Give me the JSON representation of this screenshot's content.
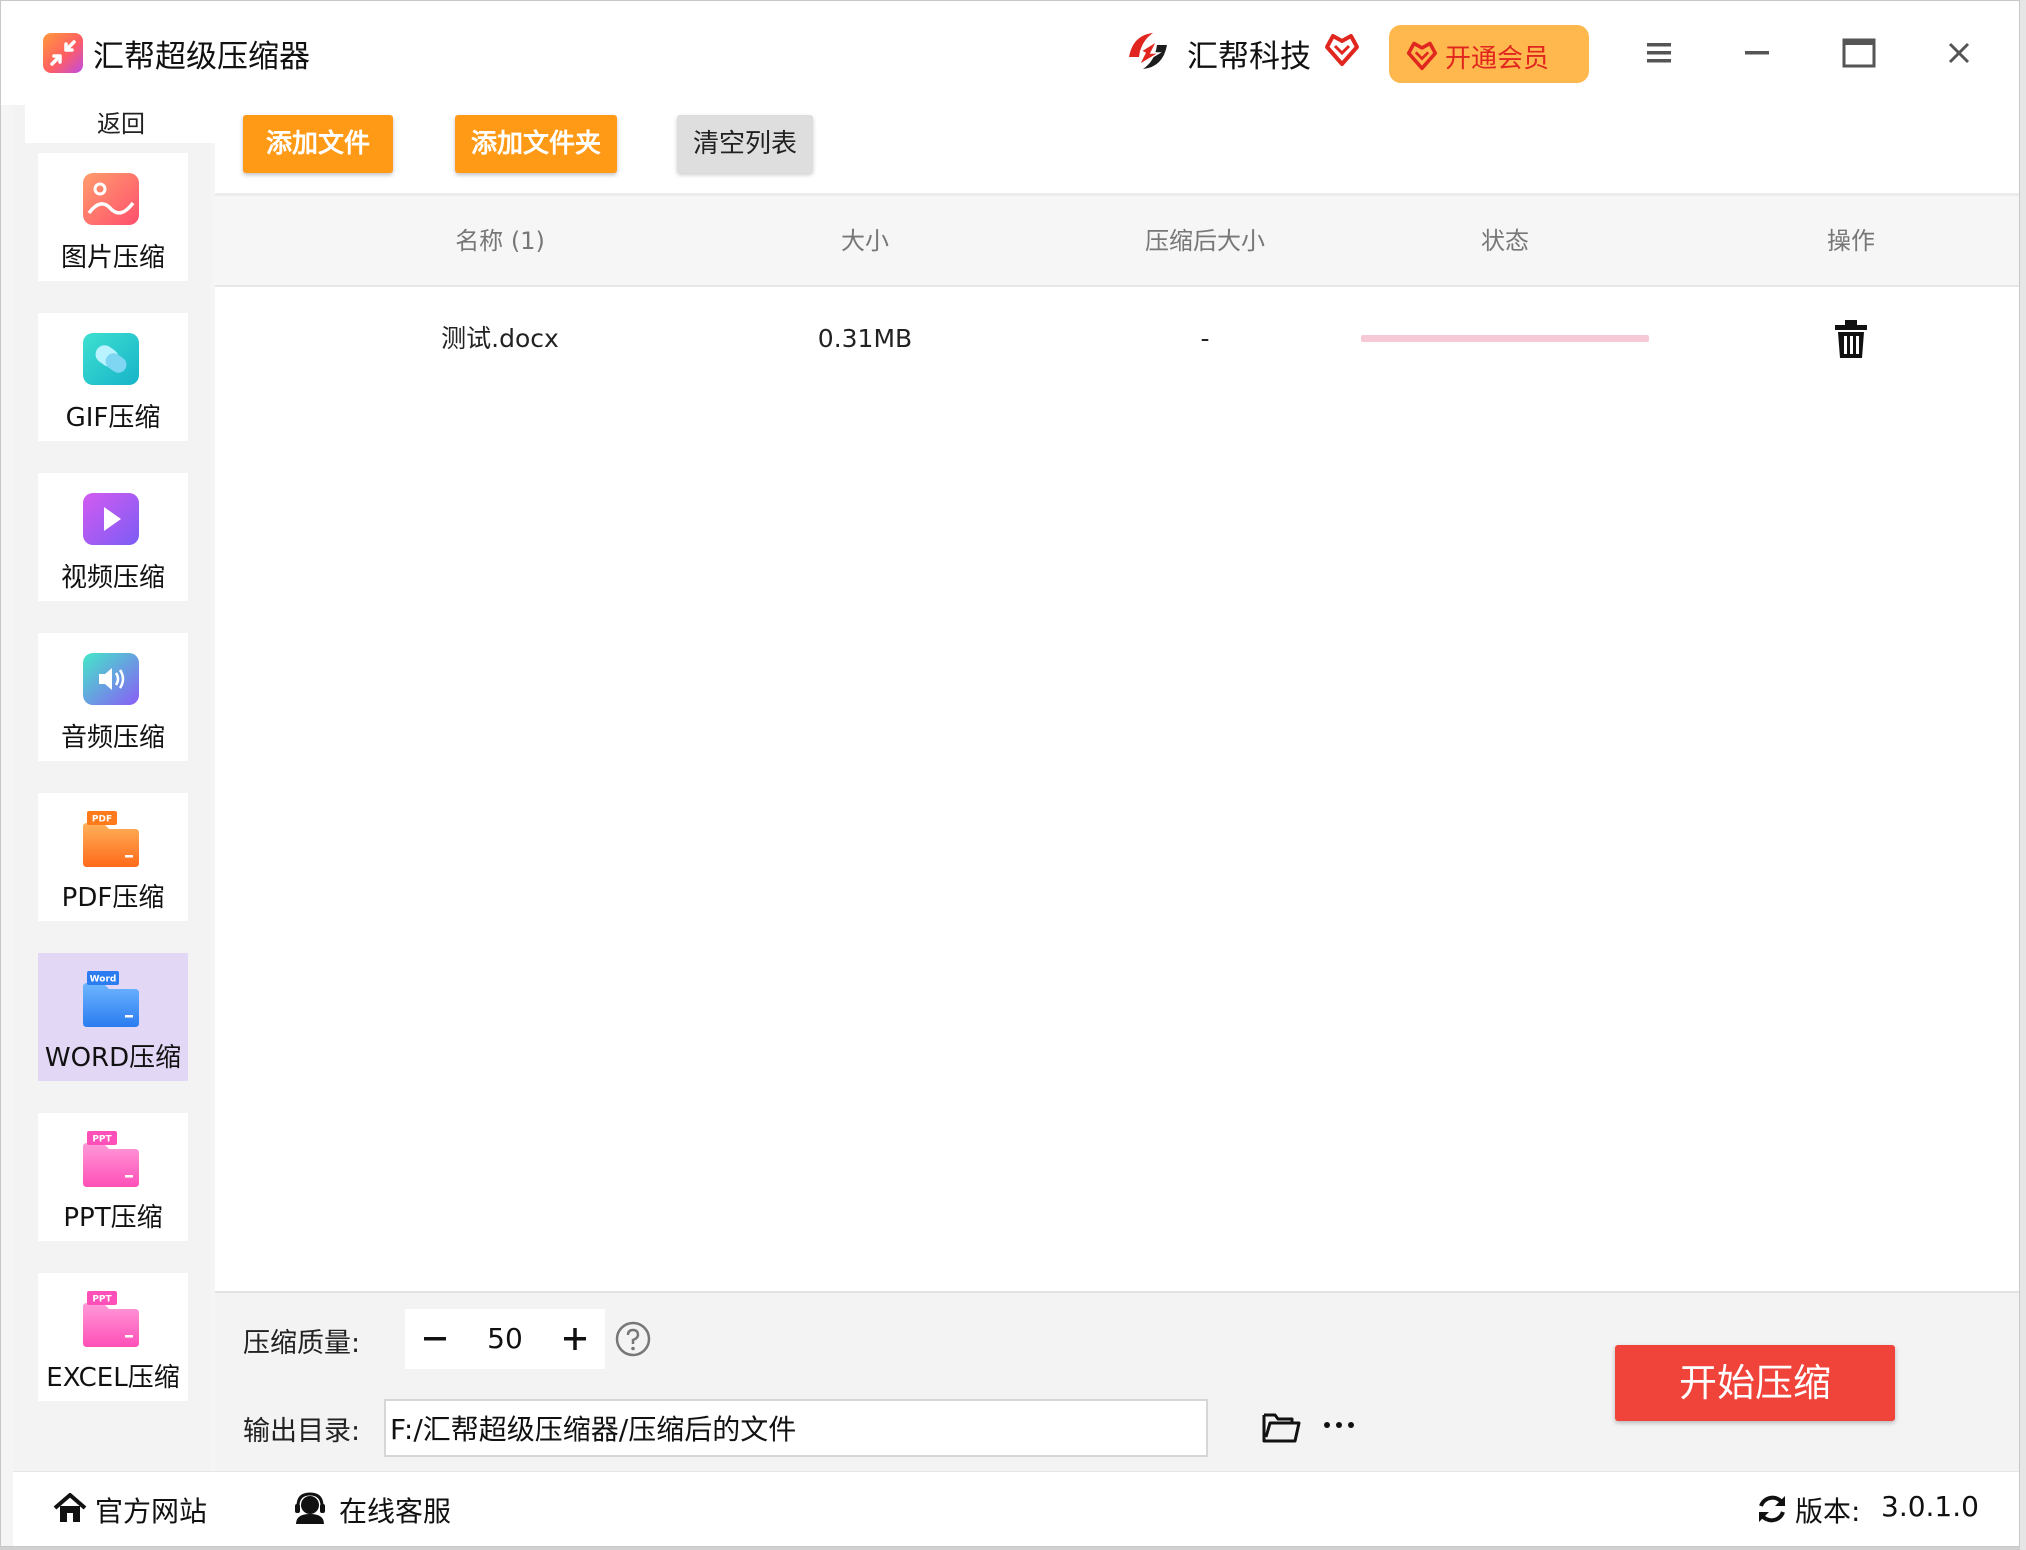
{
  "app": {
    "title": "汇帮超级压缩器",
    "brand_name": "汇帮科技",
    "vip_label": "开通会员"
  },
  "colors": {
    "accent_orange": "#ff9a17",
    "start_red": "#f0433a",
    "active_sidebar": "#e3d7f6",
    "vip_bg": "#ffb84d"
  },
  "sidebar": {
    "back_label": "返回",
    "items": [
      {
        "label": "图片压缩",
        "icon": "image-icon"
      },
      {
        "label": "GIF压缩",
        "icon": "gif-icon"
      },
      {
        "label": "视频压缩",
        "icon": "video-icon"
      },
      {
        "label": "音频压缩",
        "icon": "audio-icon"
      },
      {
        "label": "PDF压缩",
        "icon": "pdf-folder-icon",
        "badge": "PDF"
      },
      {
        "label": "WORD压缩",
        "icon": "word-folder-icon",
        "badge": "Word",
        "active": true
      },
      {
        "label": "PPT压缩",
        "icon": "ppt-folder-icon",
        "badge": "PPT"
      },
      {
        "label": "EXCEL压缩",
        "icon": "excel-folder-icon",
        "badge": "PPT"
      }
    ]
  },
  "toolbar": {
    "add_file_label": "添加文件",
    "add_folder_label": "添加文件夹",
    "clear_list_label": "清空列表"
  },
  "table": {
    "headers": [
      "名称 (1)",
      "大小",
      "压缩后大小",
      "状态",
      "操作"
    ],
    "rows": [
      {
        "name": "测试.docx",
        "size": "0.31MB",
        "compressed_size": "-",
        "progress": 0
      }
    ]
  },
  "settings": {
    "quality_label": "压缩质量:",
    "quality_value": "50",
    "output_label": "输出目录:",
    "output_path": "F:/汇帮超级压缩器/压缩后的文件",
    "start_label": "开始压缩"
  },
  "footer": {
    "website_label": "官方网站",
    "support_label": "在线客服",
    "version_label": "版本:",
    "version_value": "3.0.1.0"
  }
}
